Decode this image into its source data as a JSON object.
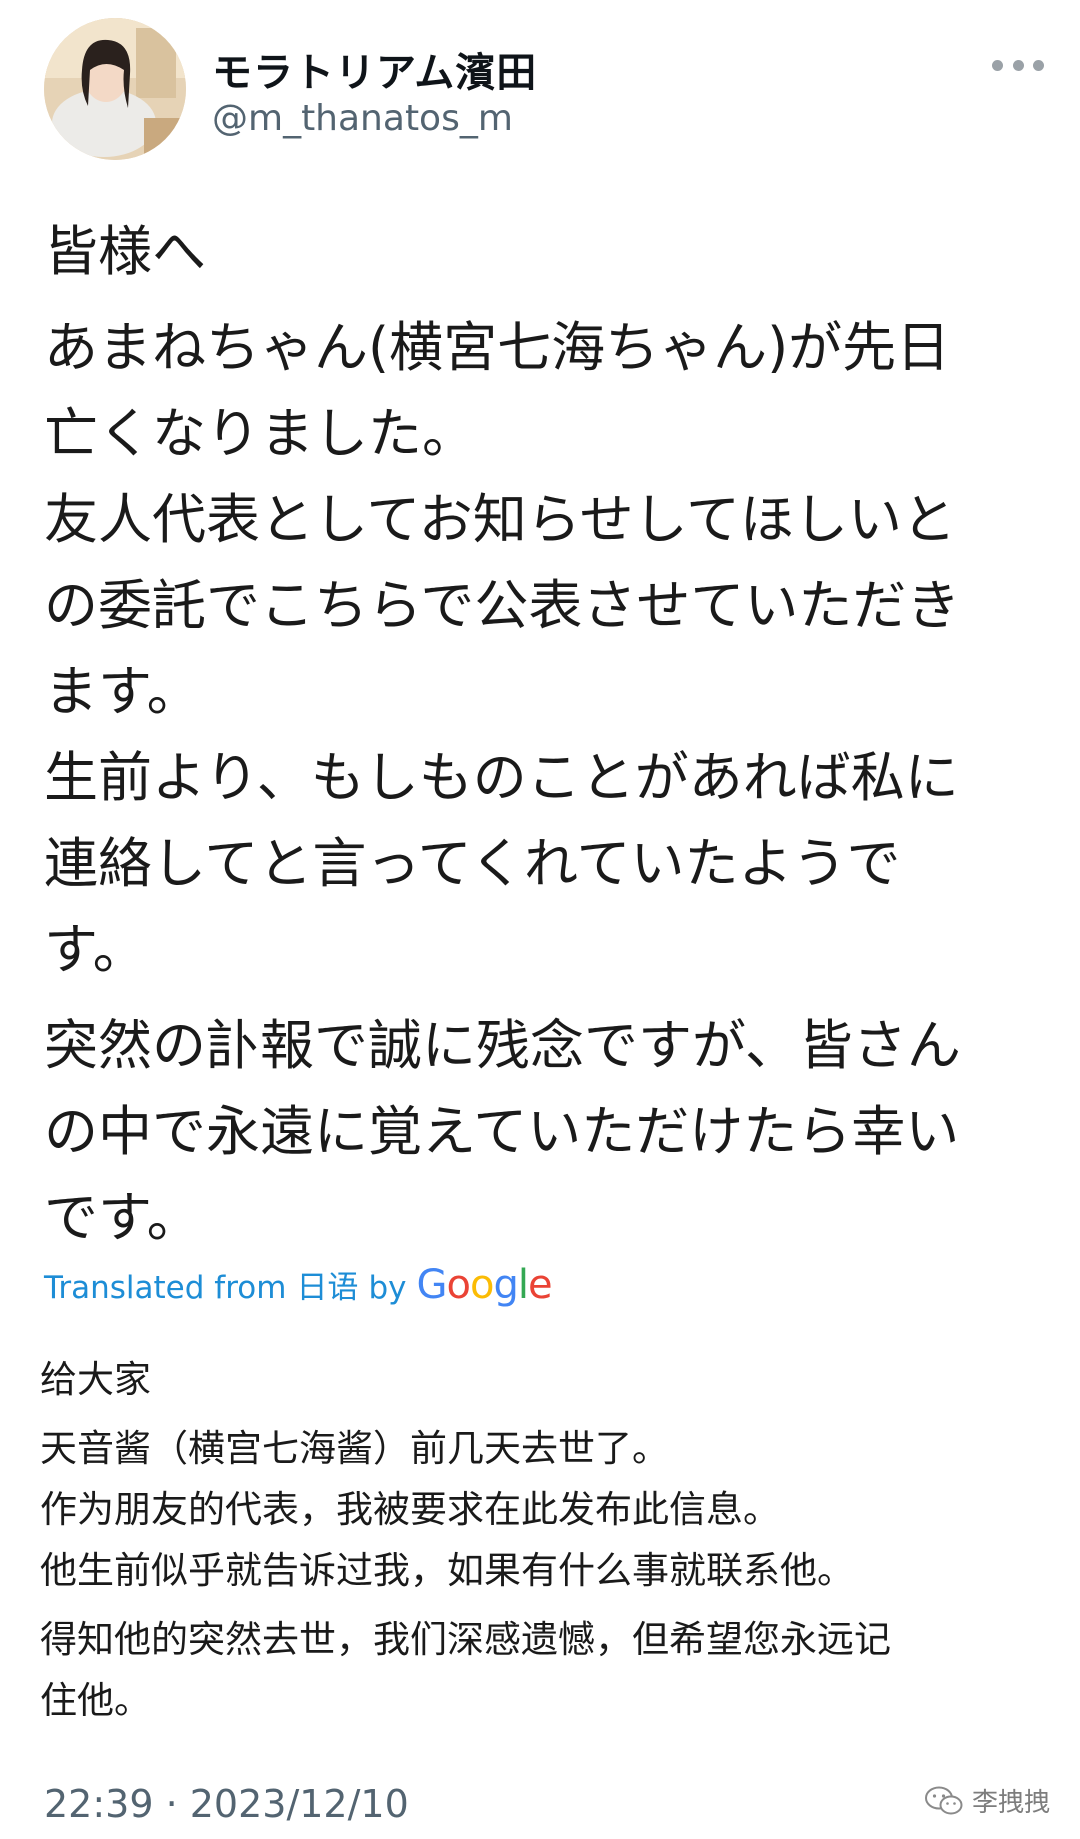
{
  "tweet": {
    "author": {
      "display_name": "モラトリアム濱田",
      "handle": "@m_thanatos_m"
    },
    "original_lines": [
      "皆様へ",
      "あまねちゃん(横宮七海ちゃん)が先日",
      "亡くなりました。",
      "友人代表としてお知らせしてほしいと",
      "の委託でこちらで公表させていただき",
      "ます。",
      "生前より、もしものことがあれば私に",
      "連絡してと言ってくれていたようで",
      "す。",
      "突然の訃報で誠に残念ですが、皆さん",
      "の中で永遠に覚えていただけたら幸い",
      "です。"
    ],
    "translation_label": {
      "prefix": "Translated from",
      "language": "日语",
      "by": "by",
      "provider": "Google"
    },
    "translated_lines": [
      "给大家",
      "天音酱（横宫七海酱）前几天去世了。",
      "作为朋友的代表，我被要求在此发布此信息。",
      "他生前似乎就告诉过我，如果有什么事就联系他。",
      "得知他的突然去世，我们深感遗憾，但希望您永远记",
      "住他。"
    ],
    "timestamp": "22:39 · 2023/12/10"
  },
  "watermark": {
    "text": "李拽拽",
    "icon": "wechat-icon"
  },
  "colors": {
    "link_blue": "#1d8dd6",
    "secondary_text": "#536471",
    "google_blue": "#4285f4",
    "google_red": "#ea4335",
    "google_yellow": "#fbbc05",
    "google_green": "#34a853"
  }
}
